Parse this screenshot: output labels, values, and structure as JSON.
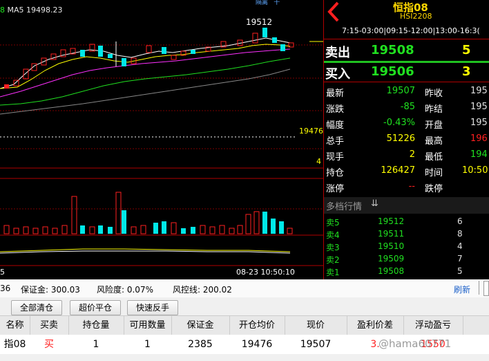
{
  "chart": {
    "ma5_prefix": "8",
    "ma5_label": "MA5 19498.23",
    "high_label": "19512",
    "ref_label": "19476",
    "right_tick": "4",
    "x_left_tick": "5",
    "x_right_tick": "08-23 10:50:10",
    "top_overlay": "隔离ㅤ十"
  },
  "panel": {
    "title": "恒指08",
    "code": "HSI2208",
    "session": "7:15-03:00|09:15-12:00|13:00-16:3(",
    "sell_label": "卖出",
    "sell_price": "19508",
    "sell_qty": "5",
    "buy_label": "买入",
    "buy_price": "19506",
    "buy_qty": "3",
    "rows": [
      {
        "l1": "最新",
        "v1": "19507",
        "l2": "昨收",
        "v2": "195"
      },
      {
        "l1": "涨跌",
        "v1": "-85",
        "l2": "昨结",
        "v2": "195"
      },
      {
        "l1": "幅度",
        "v1": "-0.43%",
        "l2": "开盘",
        "v2": "195"
      },
      {
        "l1": "总手",
        "v1": "51226",
        "l2": "最高",
        "v2": "196"
      },
      {
        "l1": "现手",
        "v1": "2",
        "l2": "最低",
        "v2": "194"
      },
      {
        "l1": "持仓",
        "v1": "126427",
        "l2": "时间",
        "v2": "10:50"
      },
      {
        "l1": "涨停",
        "v1": "--",
        "l2": "跌停",
        "v2": ""
      }
    ],
    "depth_title": "多档行情",
    "depth": [
      {
        "label": "卖5",
        "price": "19512",
        "qty": "6"
      },
      {
        "label": "卖4",
        "price": "19511",
        "qty": "8"
      },
      {
        "label": "卖3",
        "price": "19510",
        "qty": "4"
      },
      {
        "label": "卖2",
        "price": "19509",
        "qty": "7"
      },
      {
        "label": "卖1",
        "price": "19508",
        "qty": "5"
      }
    ]
  },
  "account": {
    "prefix_value": "36",
    "margin_label": "保证金: 300.03",
    "risk_label": "风险度: 0.07%",
    "risk_line_label": "风控线: 200.02",
    "refresh": "刷新"
  },
  "actions": {
    "close_all": "全部清仓",
    "over_price": "超价平仓",
    "reverse": "快速反手"
  },
  "table": {
    "headers": [
      "名称",
      "买卖",
      "持仓量",
      "可用数量",
      "保证金",
      "开仓均价",
      "现价",
      "盈利价差",
      "浮动盈亏"
    ],
    "row": [
      "指08",
      "买",
      "1",
      "1",
      "2385",
      "19476",
      "19507",
      "3.",
      "1550"
    ],
    "watermark": "@hama60771"
  }
}
